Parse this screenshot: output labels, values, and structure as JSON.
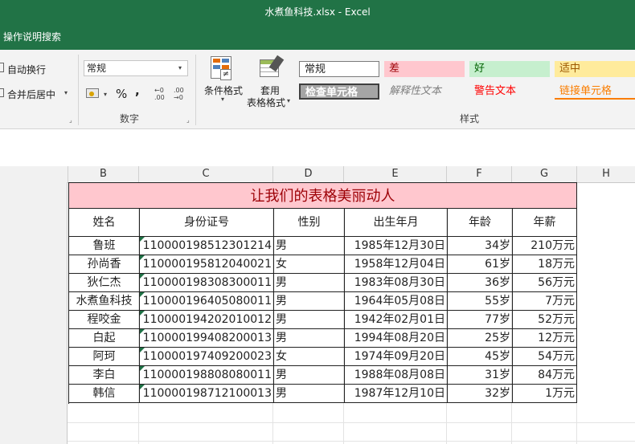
{
  "window": {
    "title": "水煮鱼科技.xlsx  -  Excel"
  },
  "tell_me": "操作说明搜索",
  "ribbon": {
    "wrap_text": "自动换行",
    "merge_center": "合并后居中",
    "number_format": "常规",
    "percent": "%",
    "comma": ",",
    "inc_decimal": "←0 .00",
    "dec_decimal": ".00 →0",
    "number_group": "数字",
    "conditional_format": "条件格式",
    "format_as_table_1": "套用",
    "format_as_table_2": "表格格式",
    "styles_group": "样式",
    "cell_styles": [
      {
        "name": "常规",
        "bg": "#ffffff",
        "color": "#222222"
      },
      {
        "name": "差",
        "bg": "#ffc7ce",
        "color": "#9c0006"
      },
      {
        "name": "好",
        "bg": "#c6efce",
        "color": "#006100"
      },
      {
        "name": "适中",
        "bg": "#ffeb9c",
        "color": "#9c5700"
      },
      {
        "name": "检查单元格",
        "bg": "#a5a5a5",
        "color": "#ffffff"
      },
      {
        "name": "解释性文本",
        "bg": "#f3f3f3",
        "color": "#7f7f7f"
      },
      {
        "name": "警告文本",
        "bg": "#f3f3f3",
        "color": "#ff0000"
      },
      {
        "name": "链接单元格",
        "bg": "#f3f3f3",
        "color": "#fa7d00"
      }
    ]
  },
  "columns": [
    "B",
    "C",
    "D",
    "E",
    "F",
    "G",
    "H"
  ],
  "table": {
    "title": "让我们的表格美丽动人",
    "headers": [
      "姓名",
      "身份证号",
      "性别",
      "出生年月",
      "年龄",
      "年薪"
    ],
    "rows": [
      [
        "鲁班",
        "110000198512301214",
        "男",
        "1985年12月30日",
        "34岁",
        "210万元"
      ],
      [
        "孙尚香",
        "110000195812040021",
        "女",
        "1958年12月04日",
        "61岁",
        "18万元"
      ],
      [
        "狄仁杰",
        "110000198308300011",
        "男",
        "1983年08月30日",
        "36岁",
        "56万元"
      ],
      [
        "水煮鱼科技",
        "110000196405080011",
        "男",
        "1964年05月08日",
        "55岁",
        "7万元"
      ],
      [
        "程咬金",
        "110000194202010012",
        "男",
        "1942年02月01日",
        "77岁",
        "52万元"
      ],
      [
        "白起",
        "110000199408200013",
        "男",
        "1994年08月20日",
        "25岁",
        "12万元"
      ],
      [
        "阿珂",
        "110000197409200023",
        "女",
        "1974年09月20日",
        "45岁",
        "54万元"
      ],
      [
        "李白",
        "110000198808080011",
        "男",
        "1988年08月08日",
        "31岁",
        "84万元"
      ],
      [
        "韩信",
        "110000198712100013",
        "男",
        "1987年12月10日",
        "32岁",
        "1万元"
      ]
    ]
  },
  "colors": {
    "excel_green": "#217346",
    "title_fill": "#ffc7ce",
    "title_text": "#9c0006",
    "marker": "#1e7145"
  }
}
